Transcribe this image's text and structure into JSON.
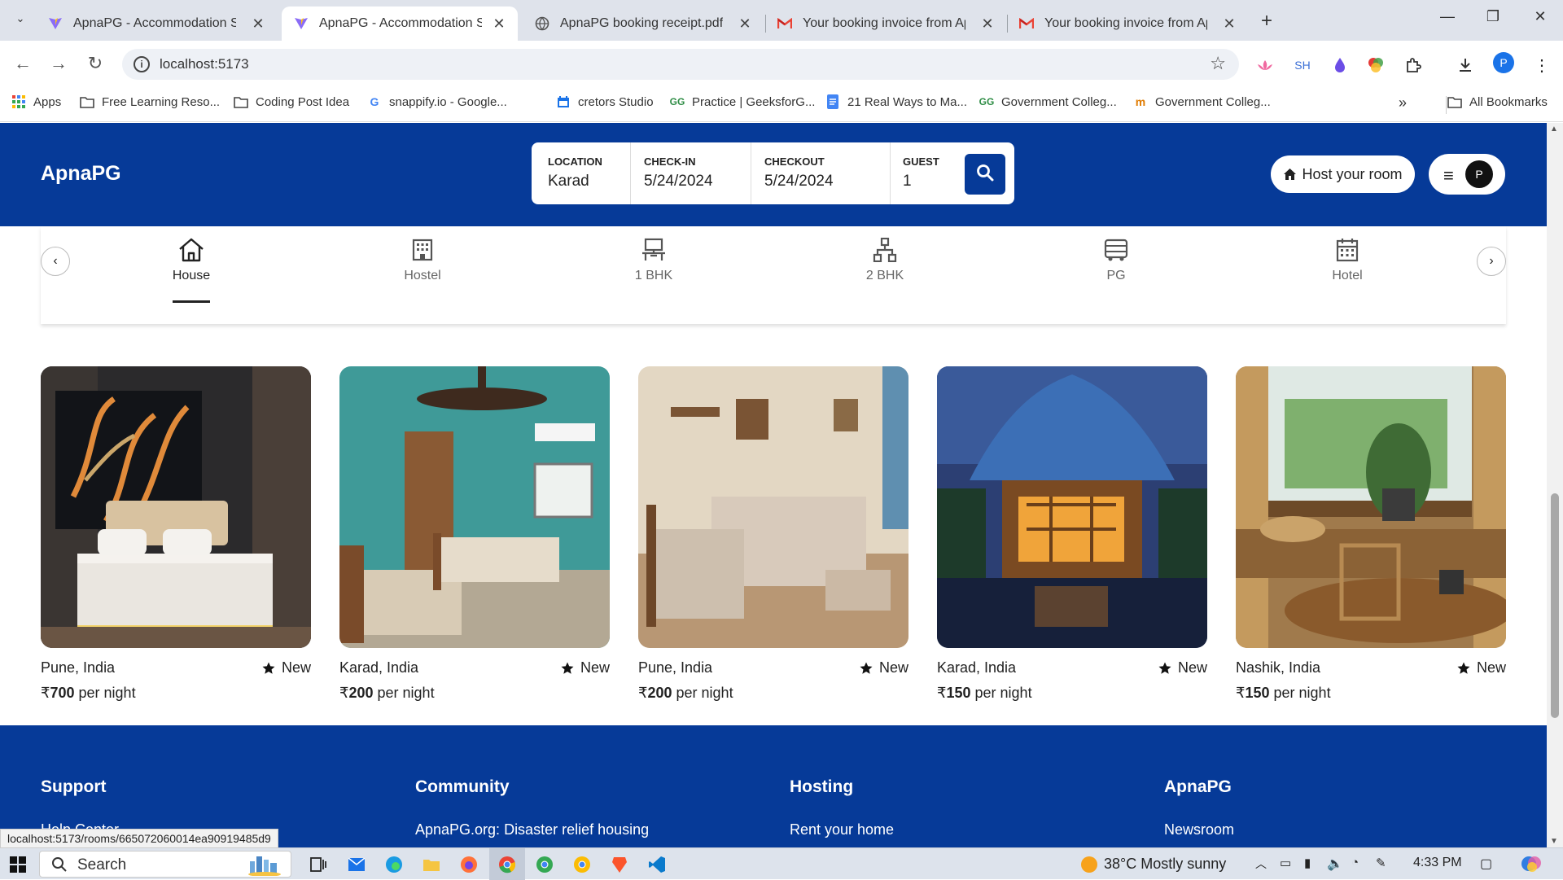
{
  "browser": {
    "tabs": [
      {
        "title": "ApnaPG - Accommodation Solu",
        "icon": "vite-icon"
      },
      {
        "title": "ApnaPG - Accommodation Solu",
        "icon": "vite-icon"
      },
      {
        "title": "ApnaPG booking receipt.pdf",
        "icon": "globe-icon"
      },
      {
        "title": "Your booking invoice from Apna",
        "icon": "gmail-icon"
      },
      {
        "title": "Your booking invoice from Apna",
        "icon": "gmail-icon"
      }
    ],
    "url": "localhost:5173",
    "bookmarks": [
      {
        "label": "Apps"
      },
      {
        "label": "Free Learning Reso..."
      },
      {
        "label": "Coding Post Idea"
      },
      {
        "label": "snappify.io - Google..."
      },
      {
        "label": "cretors Studio"
      },
      {
        "label": "Practice | GeeksforG..."
      },
      {
        "label": "21 Real Ways to Ma..."
      },
      {
        "label": "Government Colleg..."
      },
      {
        "label": "Government Colleg..."
      },
      {
        "label": "All Bookmarks"
      }
    ],
    "profile_initial": "P",
    "ext_sh": "SH",
    "status_url": "localhost:5173/rooms/665072060014ea90919485d9"
  },
  "header": {
    "logo": "ApnaPG",
    "search": {
      "location_label": "LOCATION",
      "location_value": "Karad",
      "checkin_label": "CHECK-IN",
      "checkin_value": "5/24/2024",
      "checkout_label": "CHECKOUT",
      "checkout_value": "5/24/2024",
      "guest_label": "GUEST",
      "guest_value": "1"
    },
    "host_label": "Host your room",
    "avatar_initial": "P"
  },
  "categories": [
    {
      "label": "House",
      "icon": "house-icon",
      "active": true
    },
    {
      "label": "Hostel",
      "icon": "building-icon"
    },
    {
      "label": "1 BHK",
      "icon": "desk-icon"
    },
    {
      "label": "2 BHK",
      "icon": "sitemap-icon"
    },
    {
      "label": "PG",
      "icon": "bus-icon"
    },
    {
      "label": "Hotel",
      "icon": "calendar-grid-icon"
    }
  ],
  "listings": [
    {
      "location": "Pune, India",
      "badge": "New",
      "currency": "₹",
      "price": "700",
      "unit": "per night"
    },
    {
      "location": "Karad, India",
      "badge": "New",
      "currency": "₹",
      "price": "200",
      "unit": "per night"
    },
    {
      "location": "Pune, India",
      "badge": "New",
      "currency": "₹",
      "price": "200",
      "unit": "per night"
    },
    {
      "location": "Karad, India",
      "badge": "New",
      "currency": "₹",
      "price": "150",
      "unit": "per night"
    },
    {
      "location": "Nashik, India",
      "badge": "New",
      "currency": "₹",
      "price": "150",
      "unit": "per night"
    }
  ],
  "footer": {
    "columns": [
      {
        "heading": "Support",
        "link": "Help Center"
      },
      {
        "heading": "Community",
        "link": "ApnaPG.org: Disaster relief housing"
      },
      {
        "heading": "Hosting",
        "link": "Rent your home"
      },
      {
        "heading": "ApnaPG",
        "link": "Newsroom"
      }
    ]
  },
  "taskbar": {
    "search": "Search",
    "weather": "38°C  Mostly sunny",
    "time": "4:33 PM"
  },
  "colors": {
    "brand": "#063a98"
  }
}
